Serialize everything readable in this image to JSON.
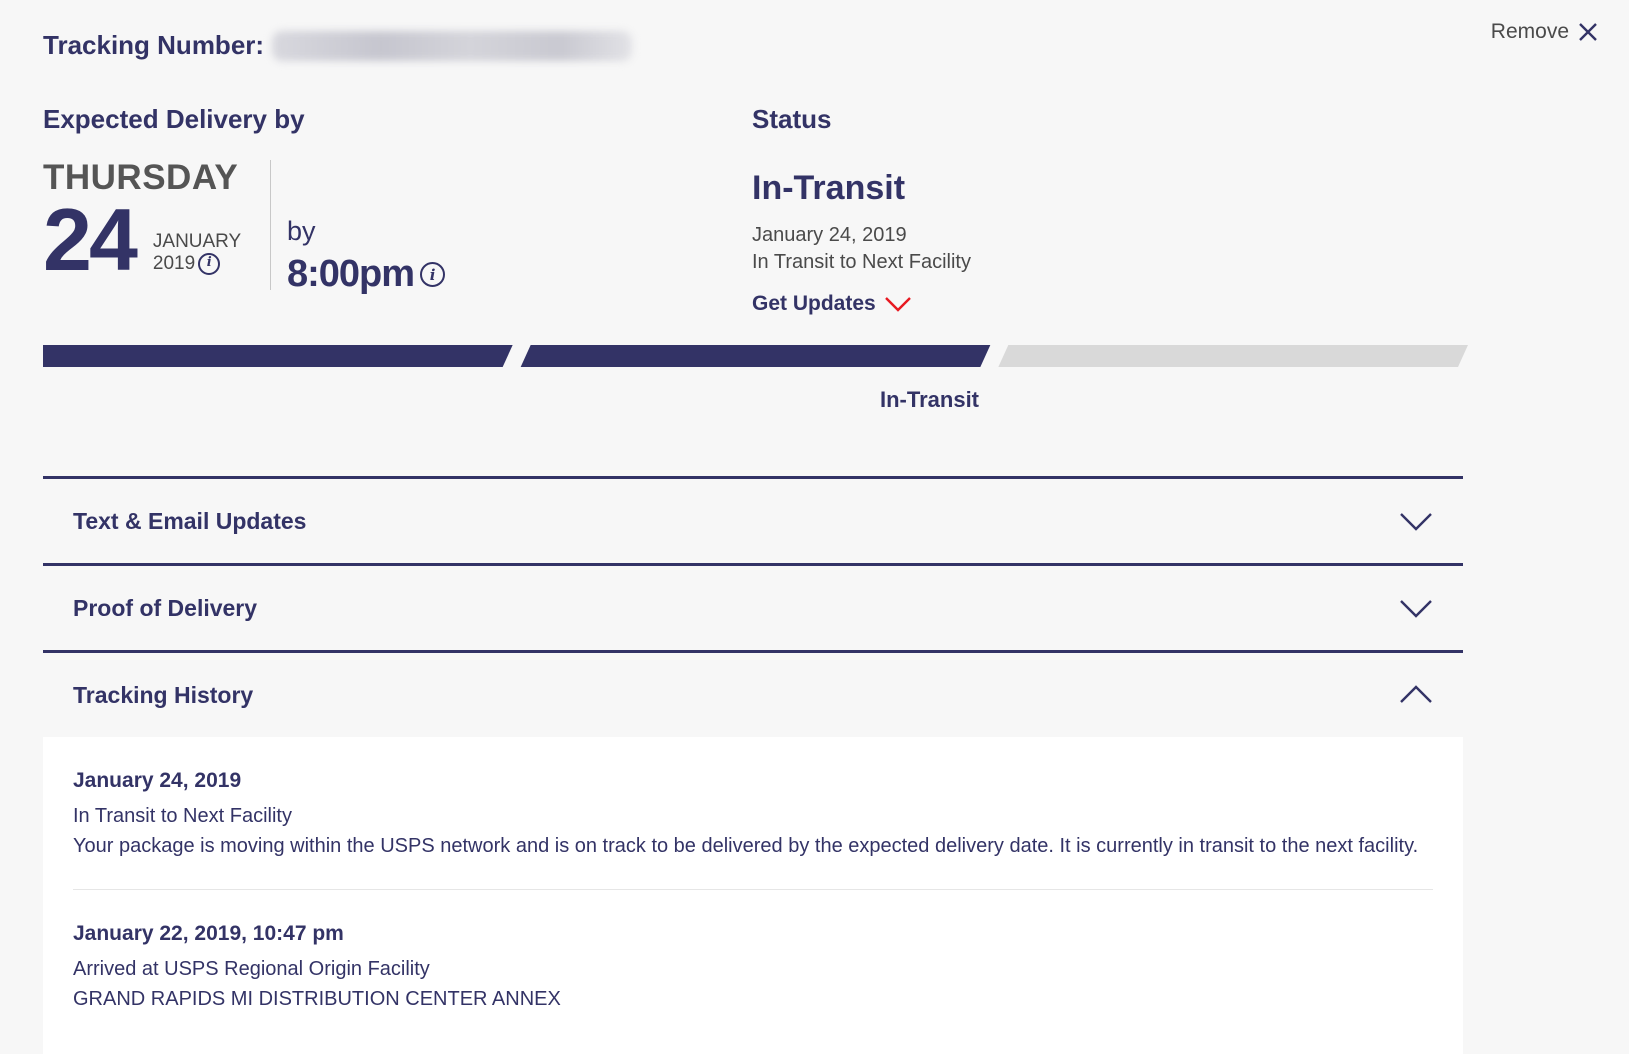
{
  "remove": {
    "label": "Remove"
  },
  "tracking": {
    "label": "Tracking Number:"
  },
  "expected": {
    "heading": "Expected Delivery by",
    "weekday": "THURSDAY",
    "day": "24",
    "month": "JANUARY",
    "year": "2019",
    "by_label": "by",
    "time": "8:00pm"
  },
  "status": {
    "heading": "Status",
    "value": "In-Transit",
    "date": "January 24, 2019",
    "description": "In Transit to Next Facility",
    "get_updates": "Get Updates"
  },
  "progress": {
    "segments_completed": 2,
    "segments_total": 3,
    "current_label": "In-Transit",
    "colors": {
      "done": "#333366",
      "pending": "#d9d9d9",
      "accent": "#e71921"
    }
  },
  "accordion": [
    {
      "title": "Text & Email Updates",
      "expanded": false
    },
    {
      "title": "Proof of Delivery",
      "expanded": false
    },
    {
      "title": "Tracking History",
      "expanded": true
    }
  ],
  "history": [
    {
      "date": "January 24, 2019",
      "event": "In Transit to Next Facility",
      "detail": "Your package is moving within the USPS network and is on track to be delivered by the expected delivery date. It is currently in transit to the next facility."
    },
    {
      "date": "January 22, 2019, 10:47 pm",
      "event": "Arrived at USPS Regional Origin Facility",
      "detail": "GRAND RAPIDS MI DISTRIBUTION CENTER ANNEX"
    }
  ]
}
